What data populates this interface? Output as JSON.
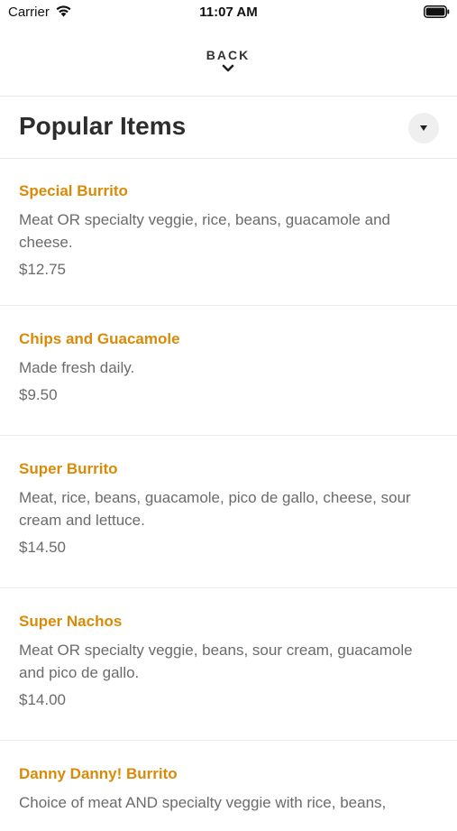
{
  "status_bar": {
    "carrier": "Carrier",
    "time": "11:07 AM"
  },
  "nav": {
    "back_label": "BACK"
  },
  "section": {
    "title": "Popular Items"
  },
  "items": [
    {
      "name": "Special Burrito",
      "description": "Meat OR specialty veggie, rice, beans, guacamole and cheese.",
      "price": "$12.75"
    },
    {
      "name": "Chips and Guacamole",
      "description": "Made fresh daily.",
      "price": "$9.50"
    },
    {
      "name": "Super Burrito",
      "description": "Meat, rice, beans, guacamole, pico de gallo, cheese, sour cream and lettuce.",
      "price": "$14.50"
    },
    {
      "name": "Super Nachos",
      "description": "Meat OR specialty veggie, beans, sour cream, guacamole and pico de gallo.",
      "price": "$14.00"
    },
    {
      "name": "Danny Danny! Burrito",
      "description": "Choice of meat AND specialty veggie with rice, beans,",
      "price": ""
    }
  ],
  "colors": {
    "item_name": "#d98b08",
    "body_text": "#6b6b6b",
    "title": "#2d2d2d",
    "divider": "#e9e9e9"
  },
  "icons": {
    "wifi": "wifi-icon",
    "battery": "battery-icon",
    "back": "chevron-down-icon",
    "dropdown": "caret-down-icon"
  }
}
